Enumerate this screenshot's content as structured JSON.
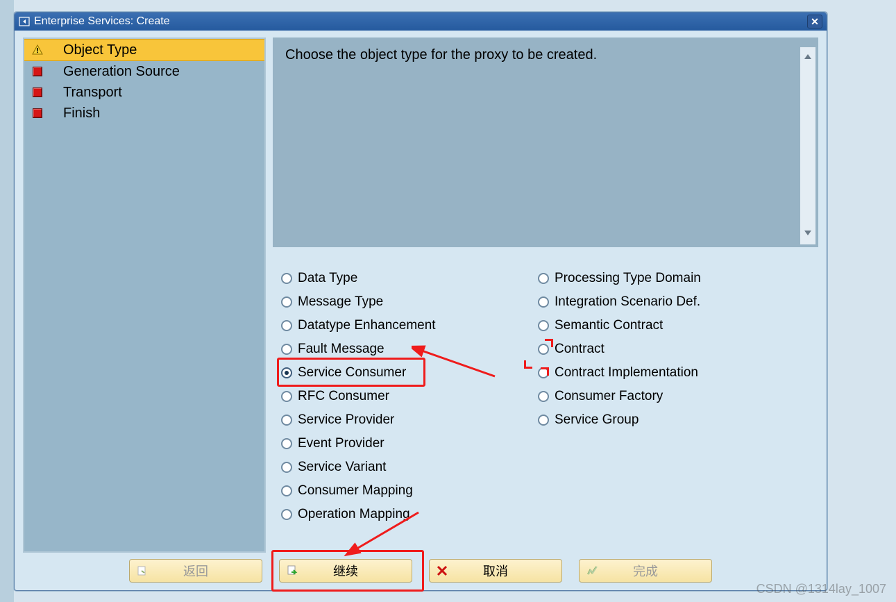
{
  "window": {
    "title": "Enterprise Services: Create",
    "close": "✕"
  },
  "nav": {
    "items": [
      {
        "label": "Object Type",
        "icon": "warning",
        "active": true
      },
      {
        "label": "Generation Source",
        "icon": "red",
        "active": false
      },
      {
        "label": "Transport",
        "icon": "red",
        "active": false
      },
      {
        "label": "Finish",
        "icon": "red",
        "active": false
      }
    ]
  },
  "instruction": "Choose the object type for the proxy to be created.",
  "options": {
    "col1": [
      {
        "label": "Data Type",
        "selected": false
      },
      {
        "label": "Message Type",
        "selected": false
      },
      {
        "label": "Datatype Enhancement",
        "selected": false
      },
      {
        "label": "Fault Message",
        "selected": false
      },
      {
        "label": "Service Consumer",
        "selected": true
      },
      {
        "label": "RFC Consumer",
        "selected": false
      },
      {
        "label": "Service Provider",
        "selected": false
      },
      {
        "label": "Event Provider",
        "selected": false
      },
      {
        "label": "Service Variant",
        "selected": false
      },
      {
        "label": "Consumer Mapping",
        "selected": false
      },
      {
        "label": "Operation Mapping",
        "selected": false
      }
    ],
    "col2": [
      {
        "label": "Processing Type Domain",
        "selected": false
      },
      {
        "label": "Integration Scenario Def.",
        "selected": false
      },
      {
        "label": "Semantic Contract",
        "selected": false
      },
      {
        "label": "Contract",
        "selected": false
      },
      {
        "label": "Contract Implementation",
        "selected": false
      },
      {
        "label": "Consumer Factory",
        "selected": false
      },
      {
        "label": "Service Group",
        "selected": false
      }
    ]
  },
  "buttons": {
    "back": "返回",
    "cont": "继续",
    "cancel": "取消",
    "finish": "完成"
  },
  "watermark": "CSDN @1314lay_1007",
  "annotation": {
    "highlight_box_option": "Service Consumer",
    "highlight_box_button": "继续",
    "corner_marker_option": "Contract Implementation",
    "arrows": 2,
    "color": "#ef1c1c"
  }
}
